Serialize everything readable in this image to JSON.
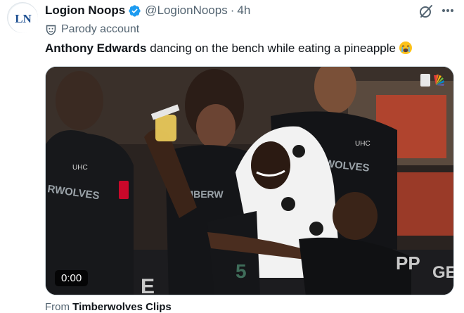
{
  "post": {
    "author_name": "Logion Noops",
    "author_handle": "@LogionNoops",
    "separator": "·",
    "timestamp": "4h",
    "label": "Parody account",
    "avatar_text": "LN",
    "text_bold": "Anthony Edwards",
    "text_rest": " dancing on the bench while eating a pineapple",
    "emoji_icon": "crying-face-icon"
  },
  "video": {
    "duration": "0:00",
    "jersey_text_left": "RWOLVES",
    "jersey_text_center": "TIMBERW",
    "jersey_text_right": "ERWOLVES",
    "jersey_number": "5",
    "sponsor_left": "UHC",
    "sponsor_right": "UHC",
    "banner_left": "E",
    "banner_right_1": "PP",
    "banner_right_2": "GE",
    "broadcaster_icon": "nbc-peacock-icon"
  },
  "from": {
    "prefix": "From",
    "source": "Timberwolves Clips"
  },
  "colors": {
    "verified": "#1d9bf0",
    "muted_text": "#536471",
    "text": "#0f1419",
    "avatar_blue": "#1d4f91"
  }
}
